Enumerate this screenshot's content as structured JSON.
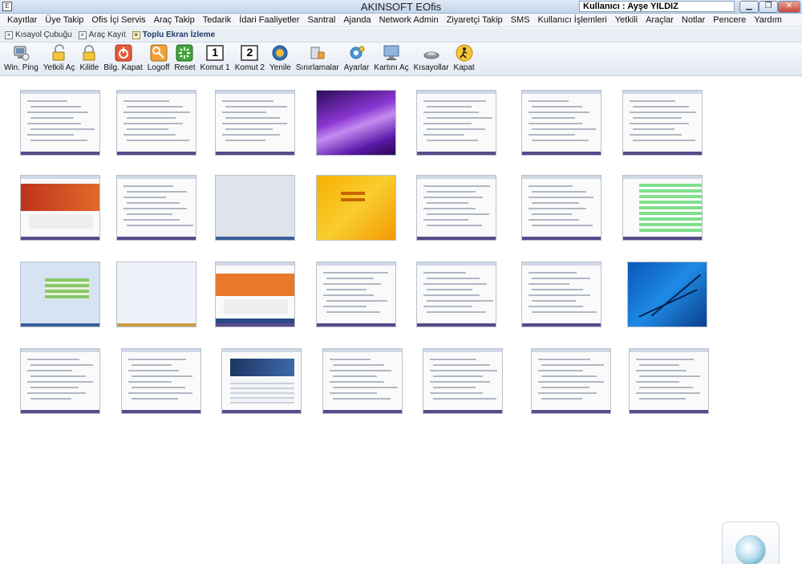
{
  "window": {
    "title": "AKINSOFT EOfis",
    "user_label": "Kullanıcı : Ayşe YILDIZ",
    "app_icon": "E"
  },
  "menu": [
    "Kayıtlar",
    "Üye Takip",
    "Ofis İçi Servis",
    "Araç Takip",
    "Tedarik",
    "İdari Faaliyetler",
    "Santral",
    "Ajanda",
    "Network Admin",
    "Ziyaretçi Takip",
    "SMS",
    "Kullanıcı İşlemleri",
    "Yetkili",
    "Araçlar",
    "Notlar",
    "Pencere",
    "Yardım"
  ],
  "tabs": [
    {
      "label": "Kısayol Çubuğu",
      "active": false
    },
    {
      "label": "Araç Kayıt",
      "active": false
    },
    {
      "label": "Toplu Ekran İzleme",
      "active": true
    }
  ],
  "toolbar": [
    {
      "label": "Win. Ping",
      "icon": "ping-icon"
    },
    {
      "label": "Yetkili Aç",
      "icon": "unlock-icon"
    },
    {
      "label": "Kilitle",
      "icon": "lock-icon"
    },
    {
      "label": "Bilg. Kapat",
      "icon": "power-icon"
    },
    {
      "label": "Logoff",
      "icon": "key-icon"
    },
    {
      "label": "Reset",
      "icon": "reset-icon"
    },
    {
      "label": "Komut 1",
      "icon": "command-1-icon",
      "glyph": "1"
    },
    {
      "label": "Komut 2",
      "icon": "command-2-icon",
      "glyph": "2"
    },
    {
      "label": "Yenile",
      "icon": "refresh-icon"
    },
    {
      "label": "Sınırlamalar",
      "icon": "restrictions-icon"
    },
    {
      "label": "Ayarlar",
      "icon": "settings-icon"
    },
    {
      "label": "Kartını Aç",
      "icon": "monitor-icon"
    },
    {
      "label": "Kısayollar",
      "icon": "shortcuts-icon"
    },
    {
      "label": "Kapat",
      "icon": "exit-icon"
    }
  ],
  "colors": {
    "taskbar": "#5a4a8a",
    "accent": "#203a6a"
  }
}
